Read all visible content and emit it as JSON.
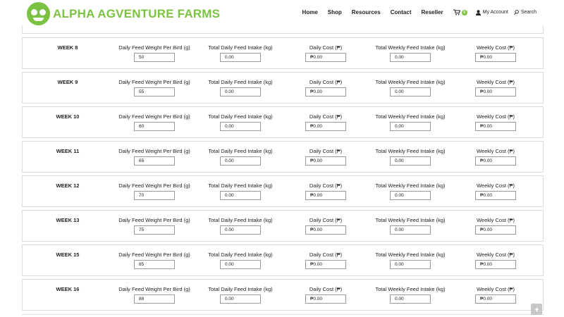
{
  "brand": {
    "name": "ALPHA AGVENTURE FARMS",
    "accent_color": "#7cc242"
  },
  "nav": {
    "items": [
      "Home",
      "Shop",
      "Resources",
      "Contact",
      "Reseller"
    ],
    "cart_count": "0",
    "cart_icon": "cart-icon",
    "account_label": "My Account",
    "account_icon": "user-icon",
    "search_label": "Search",
    "search_icon": "search-icon"
  },
  "columns": {
    "daily_weight": "Daily Feed Weight Per Bird (g)",
    "total_daily_intake": "Total Daily Feed Intake (kg)",
    "daily_cost": "Daily Cost (₱)",
    "total_weekly_intake": "Total Weekly Feed Intake (kg)",
    "weekly_cost": "Weekly Cost (₱)"
  },
  "weeks": [
    {
      "label": "WEEK 8",
      "daily_weight": "50",
      "total_daily_intake": "0.00",
      "daily_cost": "₱0.00",
      "total_weekly_intake": "0.00",
      "weekly_cost": "₱0.00"
    },
    {
      "label": "WEEK 9",
      "daily_weight": "55",
      "total_daily_intake": "0.00",
      "daily_cost": "₱0.00",
      "total_weekly_intake": "0.00",
      "weekly_cost": "₱0.00"
    },
    {
      "label": "WEEK 10",
      "daily_weight": "60",
      "total_daily_intake": "0.00",
      "daily_cost": "₱0.00",
      "total_weekly_intake": "0.00",
      "weekly_cost": "₱0.00"
    },
    {
      "label": "WEEK 11",
      "daily_weight": "65",
      "total_daily_intake": "0.00",
      "daily_cost": "₱0.00",
      "total_weekly_intake": "0.00",
      "weekly_cost": "₱0.00"
    },
    {
      "label": "WEEK 12",
      "daily_weight": "70",
      "total_daily_intake": "0.00",
      "daily_cost": "₱0.00",
      "total_weekly_intake": "0.00",
      "weekly_cost": "₱0.00"
    },
    {
      "label": "WEEK 13",
      "daily_weight": "75",
      "total_daily_intake": "0.00",
      "daily_cost": "₱0.00",
      "total_weekly_intake": "0.00",
      "weekly_cost": "₱0.00"
    },
    {
      "label": "WEEK 15",
      "daily_weight": "85",
      "total_daily_intake": "0.00",
      "daily_cost": "₱0.00",
      "total_weekly_intake": "0.00",
      "weekly_cost": "₱0.00"
    },
    {
      "label": "WEEK 16",
      "daily_weight": "88",
      "total_daily_intake": "0.00",
      "daily_cost": "₱0.00",
      "total_weekly_intake": "0.00",
      "weekly_cost": "₱0.00"
    }
  ],
  "scroll_top_icon": "arrow-up-icon"
}
